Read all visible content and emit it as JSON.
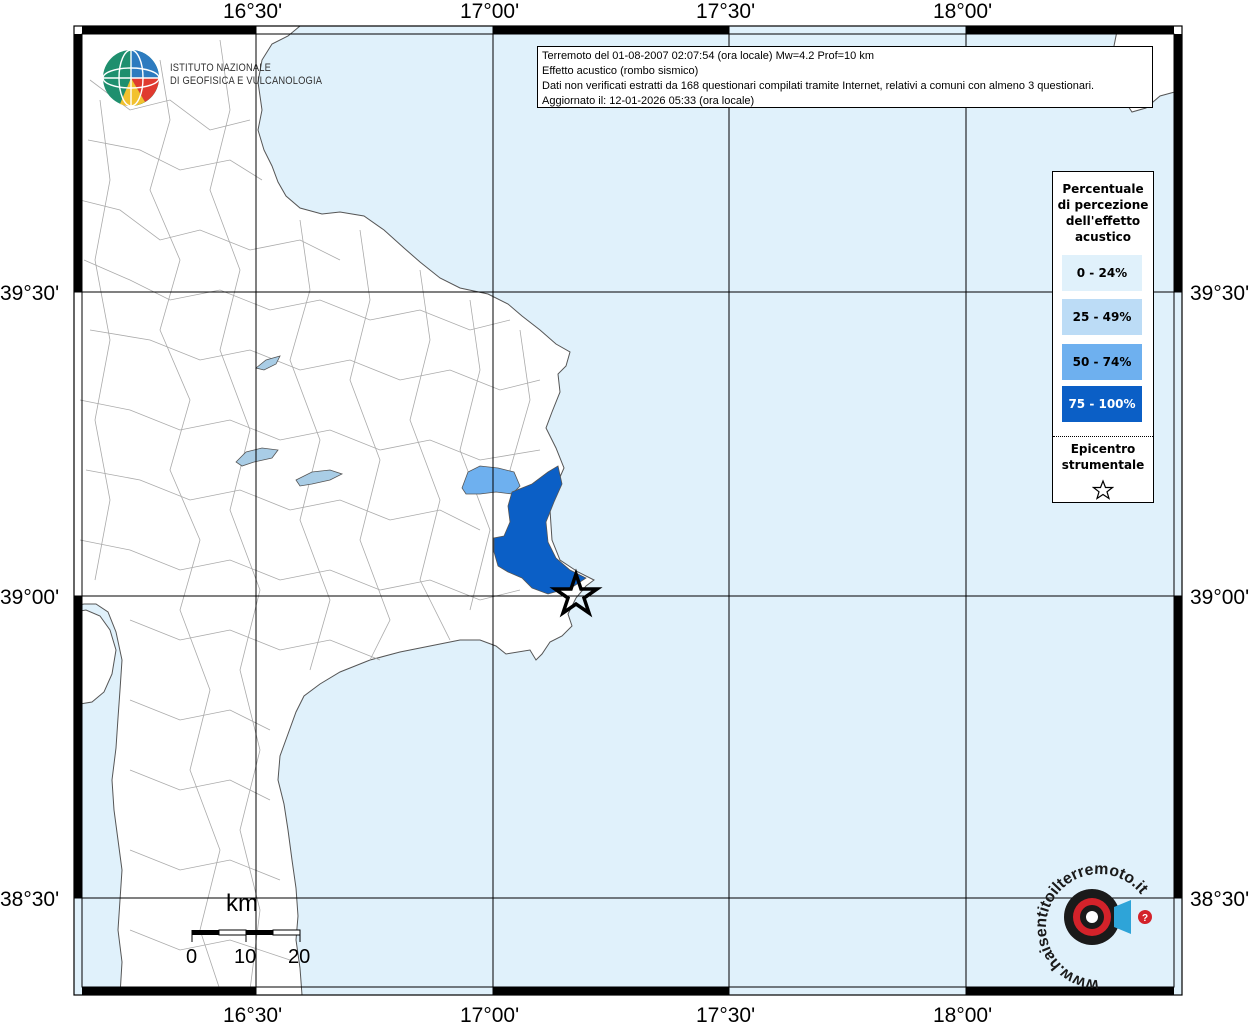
{
  "map": {
    "top_labels": [
      "16°30'",
      "17°00'",
      "17°30'",
      "18°00'"
    ],
    "bottom_labels": [
      "16°30'",
      "17°00'",
      "17°30'",
      "18°00'"
    ],
    "left_labels": [
      "39°30'",
      "39°00'",
      "38°30'"
    ],
    "right_labels": [
      "39°30'",
      "39°00'",
      "38°30'"
    ],
    "colors": {
      "sea": "#e0f1fb",
      "land": "#ffffff",
      "boundary": "#aaaaaa",
      "lake": "#a9cde6",
      "class_0_24": "#e0f1fb",
      "class_25_49": "#bcdcf6",
      "class_50_74": "#6eb0ef",
      "class_75_100": "#0b5fc6"
    }
  },
  "info": {
    "line1": "Terremoto del 01-08-2007 02:07:54 (ora locale) Mw=4.2 Prof=10 km",
    "line2": "Effetto acustico (rombo sismico)",
    "line3": "Dati non verificati estratti da 168 questionari compilati tramite Internet, relativi a comuni con almeno 3 questionari.",
    "line4": "Aggiornato il: 12-01-2026 05:33 (ora locale)"
  },
  "legend": {
    "title_l1": "Percentuale",
    "title_l2": "di percezione",
    "title_l3": "dell'effetto",
    "title_l4": "acustico",
    "items": [
      {
        "label": "0 - 24%",
        "color": "#e0f1fb"
      },
      {
        "label": "25 - 49%",
        "color": "#bcdcf6"
      },
      {
        "label": "50 - 74%",
        "color": "#6eb0ef"
      },
      {
        "label": "75 - 100%",
        "color": "#0b5fc6"
      }
    ],
    "epicenter_l1": "Epicentro",
    "epicenter_l2": "strumentale",
    "epicenter_icon": "star-outline-icon"
  },
  "logo": {
    "line1": "ISTITUTO NAZIONALE",
    "line2": "DI GEOFISICA E VULCANOLOGIA"
  },
  "scale": {
    "unit": "km",
    "ticks": [
      "0",
      "10",
      "20"
    ]
  },
  "hst": {
    "text": "www.haisentitoilterremoto.it"
  }
}
